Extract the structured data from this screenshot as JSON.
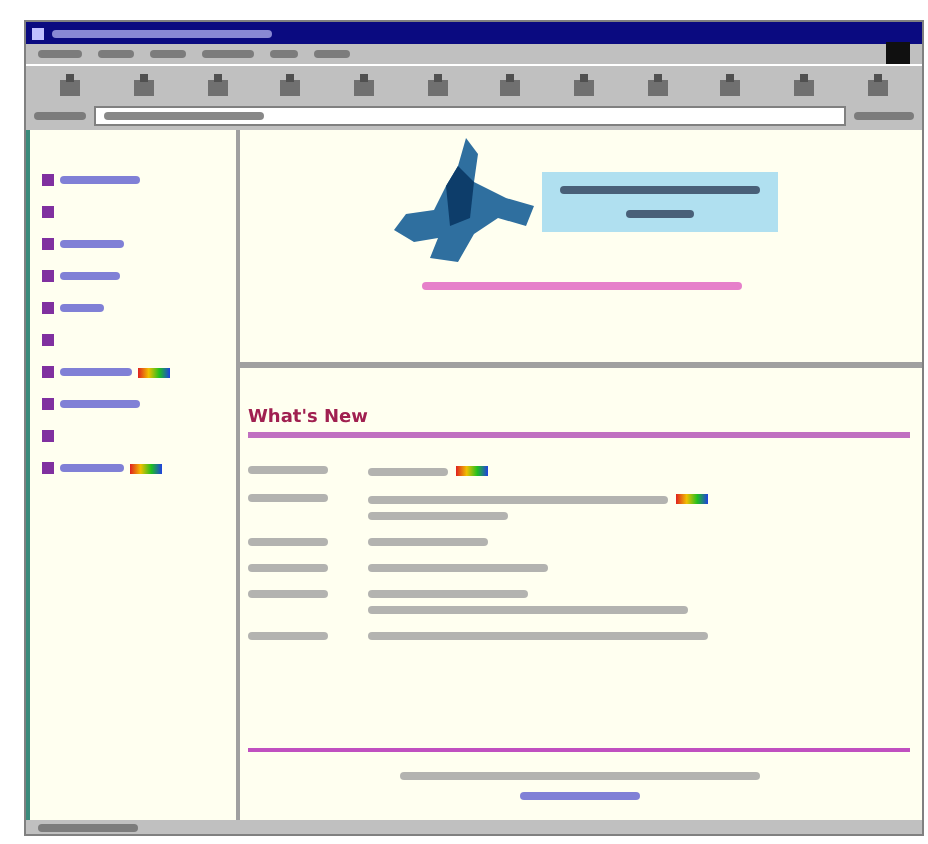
{
  "sidebar": {
    "items": [
      {
        "has_label": true,
        "new_badge": false
      },
      {
        "has_label": false,
        "new_badge": false
      },
      {
        "has_label": true,
        "new_badge": false
      },
      {
        "has_label": true,
        "new_badge": false
      },
      {
        "has_label": true,
        "new_badge": false
      },
      {
        "has_label": false,
        "new_badge": false
      },
      {
        "has_label": true,
        "new_badge": true
      },
      {
        "has_label": true,
        "new_badge": false
      },
      {
        "has_label": false,
        "new_badge": false
      },
      {
        "has_label": true,
        "new_badge": true
      }
    ]
  },
  "news": {
    "heading": "What's New",
    "items": [
      {
        "two_lines": false,
        "new_badge": true
      },
      {
        "two_lines": true,
        "new_badge": true
      },
      {
        "two_lines": false,
        "new_badge": false
      },
      {
        "two_lines": false,
        "new_badge": false
      },
      {
        "two_lines": true,
        "new_badge": false
      },
      {
        "two_lines": false,
        "new_badge": false
      }
    ]
  }
}
